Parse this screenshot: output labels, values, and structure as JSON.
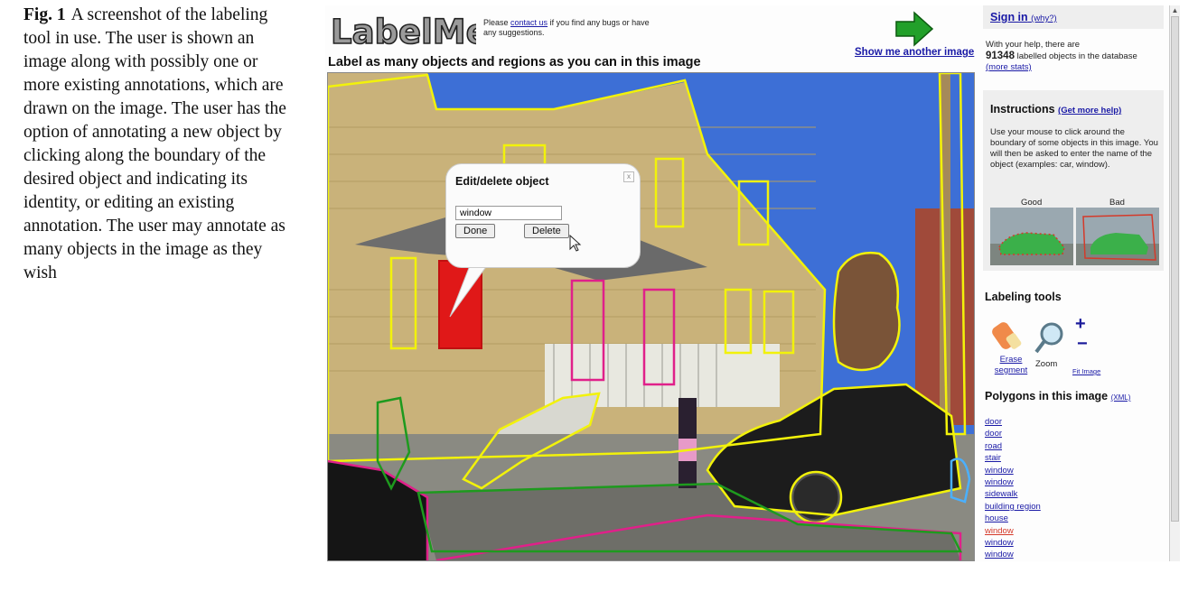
{
  "caption": {
    "label": "Fig. 1",
    "text": "A screenshot of the labeling tool in use. The user is shown an image along with possibly one or more existing annotations, which are drawn on the image. The user has the option of annotating a new object by clicking along the boundary of the desired object and indicating its identity, or editing an existing annotation. The user may annotate as many objects in the image as they wish"
  },
  "header": {
    "logo_text": "LabelMe",
    "note_pre": "Please ",
    "note_link": "contact us",
    "note_post": " if you find any bugs or have any suggestions.",
    "show_another": "Show me another image",
    "heading": "Label as many objects and regions as you can in this image"
  },
  "dialog": {
    "title": "Edit/delete object",
    "close": "x",
    "input_value": "window",
    "done_label": "Done",
    "delete_label": "Delete"
  },
  "sidebar": {
    "signin": "Sign in",
    "why": "(why?)",
    "help_text": "With your help, there are",
    "count": "91348",
    "count_suffix": " labelled objects in the database",
    "more_stats": "(more stats)",
    "instructions_title": "Instructions",
    "get_more_help": "(Get more help)",
    "instructions_text": "Use your mouse to click around the boundary of some objects in this image. You will then be asked to enter the name of the object (examples: car, window).",
    "good_label": "Good",
    "bad_label": "Bad",
    "tools_title": "Labeling tools",
    "erase_label_1": "Erase",
    "erase_label_2": "segment",
    "zoom_label": "Zoom",
    "fit_image": "Fit Image",
    "zoom_in": "+",
    "zoom_out": "−",
    "polygons_title": "Polygons in this image",
    "xml_link": "(XML)",
    "polygons": [
      "door",
      "door",
      "road",
      "stair",
      "window",
      "window",
      "sidewalk",
      "building region",
      "house",
      "window",
      "window",
      "window"
    ],
    "active_polygon_index": 9
  },
  "colors": {
    "link": "#1a1aa6",
    "active": "#d43a2a",
    "yellow_outline": "#f2f20a",
    "pink_outline": "#e0208a",
    "green_outline": "#1e9a1e"
  }
}
